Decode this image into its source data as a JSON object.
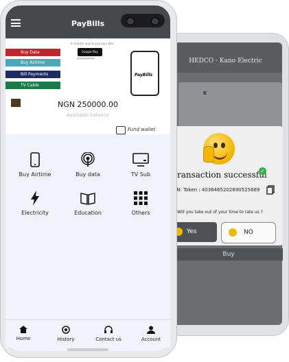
{
  "front": {
    "header": {
      "title": "PayBills"
    },
    "banner": {
      "tagline": "A smarter way to pay your bills",
      "pills": [
        {
          "label": "Buy Data",
          "color": "#c0262d"
        },
        {
          "label": "Buy Airtime",
          "color": "#4aa8b8"
        },
        {
          "label": "Bill Payments",
          "color": "#1c2c63"
        },
        {
          "label": "TV Cable",
          "color": "#1b7a4a"
        }
      ],
      "store_button": "Google Play",
      "store_sub": "bit.ly/paybillsapp",
      "phone_logo": "PayBills"
    },
    "wallet": {
      "amount": "NGN 250000.00",
      "balance_label": "Available balance",
      "fund_label": "Fund wallet"
    },
    "services": [
      {
        "label": "Buy Airtime",
        "icon": "phone-icon"
      },
      {
        "label": "Buy data",
        "icon": "broadcast-icon"
      },
      {
        "label": "TV Sub",
        "icon": "tv-icon"
      },
      {
        "label": "Electricity",
        "icon": "lightning-icon"
      },
      {
        "label": "Education",
        "icon": "book-icon"
      },
      {
        "label": "Others",
        "icon": "grid-icon"
      }
    ],
    "nav": [
      {
        "label": "Home",
        "icon": "home-icon"
      },
      {
        "label": "History",
        "icon": "history-icon"
      },
      {
        "label": "Contact us",
        "icon": "headset-icon"
      },
      {
        "label": "Account",
        "icon": "person-icon"
      }
    ]
  },
  "back": {
    "header": "HEDCO - Kano Electric",
    "logo_text": "K",
    "dialog": {
      "title": "Transaction successful",
      "token": "REN: Token : 4036465202690525669",
      "prompt": "Will you take out of your time to rate us ?",
      "yes": "Yes",
      "no": "NO"
    },
    "buy": "Buy"
  },
  "colors": {
    "header": "#46484c",
    "screen_bg": "#f1f3fa",
    "success": "#2fb34a",
    "emoji": "#f2b705"
  }
}
